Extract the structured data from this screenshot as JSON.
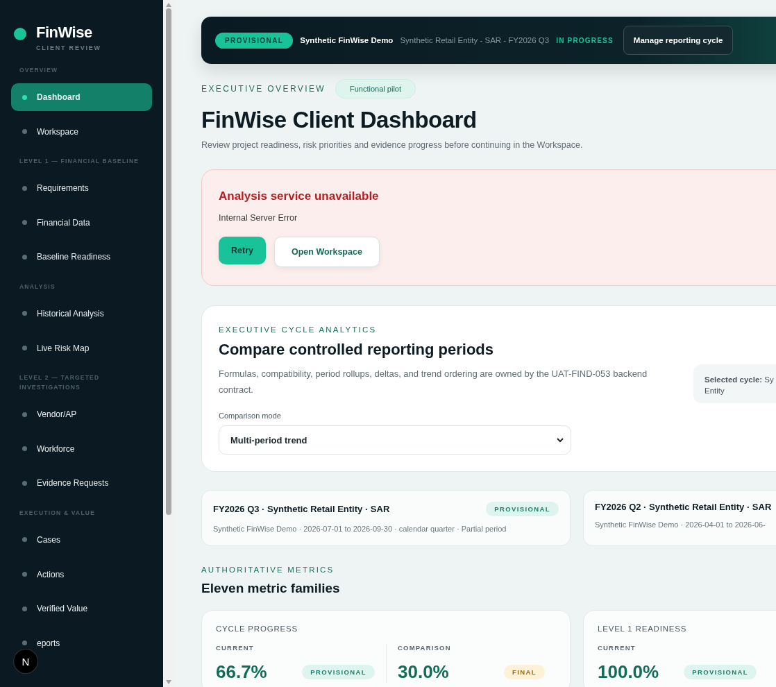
{
  "brand": {
    "name": "FinWise",
    "subtitle": "CLIENT REVIEW"
  },
  "sidebar": {
    "sections": [
      {
        "label": "OVERVIEW",
        "items": [
          {
            "label": "Dashboard",
            "selected": true
          },
          {
            "label": "Workspace",
            "selected": false
          }
        ]
      },
      {
        "label": "LEVEL 1 — FINANCIAL BASELINE",
        "items": [
          {
            "label": "Requirements",
            "selected": false
          },
          {
            "label": "Financial Data",
            "selected": false
          },
          {
            "label": "Baseline Readiness",
            "selected": false
          }
        ]
      },
      {
        "label": "ANALYSIS",
        "items": [
          {
            "label": "Historical Analysis",
            "selected": false
          },
          {
            "label": "Live Risk Map",
            "selected": false
          }
        ]
      },
      {
        "label": "LEVEL 2 — TARGETED INVESTIGATIONS",
        "items": [
          {
            "label": "Vendor/AP",
            "selected": false
          },
          {
            "label": "Workforce",
            "selected": false
          },
          {
            "label": "Evidence Requests",
            "selected": false
          }
        ]
      },
      {
        "label": "EXECUTION & VALUE",
        "items": [
          {
            "label": "Cases",
            "selected": false
          },
          {
            "label": "Actions",
            "selected": false
          },
          {
            "label": "Verified Value",
            "selected": false
          },
          {
            "label": "eports",
            "selected": false
          }
        ]
      }
    ],
    "dev_badge": "N"
  },
  "header": {
    "status": "PROVISIONAL",
    "project": "Synthetic FinWise Demo",
    "context": "Synthetic Retail Entity - SAR - FY2026 Q3",
    "progress": "IN PROGRESS",
    "button": "Manage reporting cycle"
  },
  "overview": {
    "eyebrow": "EXECUTIVE OVERVIEW",
    "tag": "Functional pilot",
    "title": "FinWise Client Dashboard",
    "subtitle": "Review project readiness, risk priorities and evidence progress before continuing in the Workspace."
  },
  "alert": {
    "title": "Analysis service unavailable",
    "message": "Internal Server Error",
    "buttons": [
      {
        "label": "Retry",
        "kind": "primary"
      },
      {
        "label": "Open Workspace",
        "kind": "secondary"
      }
    ]
  },
  "analytics": {
    "eyebrow": "EXECUTIVE CYCLE ANALYTICS",
    "title": "Compare controlled reporting periods",
    "description": "Formulas, compatibility, period rollups, deltas, and trend ordering are owned by the UAT-FIND-053 backend contract.",
    "selected_label": "Selected cycle:",
    "selected_value": "Sy",
    "selected_line2": "Entity",
    "field_label": "Comparison mode",
    "field_value": "Multi-period trend"
  },
  "periods": [
    {
      "title": "FY2026 Q3 · Synthetic Retail Entity · SAR",
      "badge": "PROVISIONAL",
      "meta": "Synthetic FinWise Demo · 2026-07-01 to 2026-09-30 · calendar quarter · Partial period"
    },
    {
      "title": "FY2026 Q2 · Synthetic Retail Entity · SAR",
      "meta": "Synthetic FinWise Demo · 2026-04-01 to 2026-06-"
    }
  ],
  "metrics_section": {
    "eyebrow": "AUTHORITATIVE METRICS",
    "title": "Eleven metric families"
  },
  "metrics": [
    {
      "title": "CYCLE PROGRESS",
      "columns": [
        {
          "label": "CURRENT",
          "value": "66.7%",
          "badge": "PROVISIONAL",
          "kind": "provisional"
        },
        {
          "label": "COMPARISON",
          "value": "30.0%",
          "badge": "FINAL",
          "kind": "final"
        }
      ]
    },
    {
      "title": "LEVEL 1 READINESS",
      "columns": [
        {
          "label": "CURRENT",
          "value": "100.0%",
          "badge": "PROVISIONAL",
          "kind": "provisional"
        }
      ]
    }
  ]
}
